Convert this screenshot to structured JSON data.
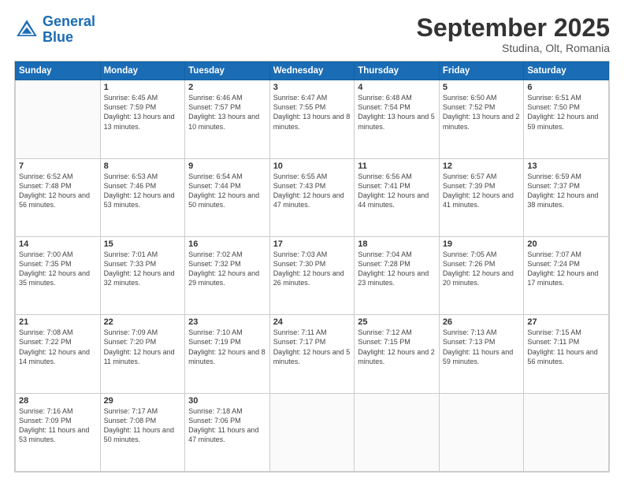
{
  "logo": {
    "line1": "General",
    "line2": "Blue"
  },
  "title": "September 2025",
  "subtitle": "Studina, Olt, Romania",
  "days_header": [
    "Sunday",
    "Monday",
    "Tuesday",
    "Wednesday",
    "Thursday",
    "Friday",
    "Saturday"
  ],
  "weeks": [
    [
      {
        "day": "",
        "sunrise": "",
        "sunset": "",
        "daylight": ""
      },
      {
        "day": "1",
        "sunrise": "Sunrise: 6:45 AM",
        "sunset": "Sunset: 7:59 PM",
        "daylight": "Daylight: 13 hours and 13 minutes."
      },
      {
        "day": "2",
        "sunrise": "Sunrise: 6:46 AM",
        "sunset": "Sunset: 7:57 PM",
        "daylight": "Daylight: 13 hours and 10 minutes."
      },
      {
        "day": "3",
        "sunrise": "Sunrise: 6:47 AM",
        "sunset": "Sunset: 7:55 PM",
        "daylight": "Daylight: 13 hours and 8 minutes."
      },
      {
        "day": "4",
        "sunrise": "Sunrise: 6:48 AM",
        "sunset": "Sunset: 7:54 PM",
        "daylight": "Daylight: 13 hours and 5 minutes."
      },
      {
        "day": "5",
        "sunrise": "Sunrise: 6:50 AM",
        "sunset": "Sunset: 7:52 PM",
        "daylight": "Daylight: 13 hours and 2 minutes."
      },
      {
        "day": "6",
        "sunrise": "Sunrise: 6:51 AM",
        "sunset": "Sunset: 7:50 PM",
        "daylight": "Daylight: 12 hours and 59 minutes."
      }
    ],
    [
      {
        "day": "7",
        "sunrise": "Sunrise: 6:52 AM",
        "sunset": "Sunset: 7:48 PM",
        "daylight": "Daylight: 12 hours and 56 minutes."
      },
      {
        "day": "8",
        "sunrise": "Sunrise: 6:53 AM",
        "sunset": "Sunset: 7:46 PM",
        "daylight": "Daylight: 12 hours and 53 minutes."
      },
      {
        "day": "9",
        "sunrise": "Sunrise: 6:54 AM",
        "sunset": "Sunset: 7:44 PM",
        "daylight": "Daylight: 12 hours and 50 minutes."
      },
      {
        "day": "10",
        "sunrise": "Sunrise: 6:55 AM",
        "sunset": "Sunset: 7:43 PM",
        "daylight": "Daylight: 12 hours and 47 minutes."
      },
      {
        "day": "11",
        "sunrise": "Sunrise: 6:56 AM",
        "sunset": "Sunset: 7:41 PM",
        "daylight": "Daylight: 12 hours and 44 minutes."
      },
      {
        "day": "12",
        "sunrise": "Sunrise: 6:57 AM",
        "sunset": "Sunset: 7:39 PM",
        "daylight": "Daylight: 12 hours and 41 minutes."
      },
      {
        "day": "13",
        "sunrise": "Sunrise: 6:59 AM",
        "sunset": "Sunset: 7:37 PM",
        "daylight": "Daylight: 12 hours and 38 minutes."
      }
    ],
    [
      {
        "day": "14",
        "sunrise": "Sunrise: 7:00 AM",
        "sunset": "Sunset: 7:35 PM",
        "daylight": "Daylight: 12 hours and 35 minutes."
      },
      {
        "day": "15",
        "sunrise": "Sunrise: 7:01 AM",
        "sunset": "Sunset: 7:33 PM",
        "daylight": "Daylight: 12 hours and 32 minutes."
      },
      {
        "day": "16",
        "sunrise": "Sunrise: 7:02 AM",
        "sunset": "Sunset: 7:32 PM",
        "daylight": "Daylight: 12 hours and 29 minutes."
      },
      {
        "day": "17",
        "sunrise": "Sunrise: 7:03 AM",
        "sunset": "Sunset: 7:30 PM",
        "daylight": "Daylight: 12 hours and 26 minutes."
      },
      {
        "day": "18",
        "sunrise": "Sunrise: 7:04 AM",
        "sunset": "Sunset: 7:28 PM",
        "daylight": "Daylight: 12 hours and 23 minutes."
      },
      {
        "day": "19",
        "sunrise": "Sunrise: 7:05 AM",
        "sunset": "Sunset: 7:26 PM",
        "daylight": "Daylight: 12 hours and 20 minutes."
      },
      {
        "day": "20",
        "sunrise": "Sunrise: 7:07 AM",
        "sunset": "Sunset: 7:24 PM",
        "daylight": "Daylight: 12 hours and 17 minutes."
      }
    ],
    [
      {
        "day": "21",
        "sunrise": "Sunrise: 7:08 AM",
        "sunset": "Sunset: 7:22 PM",
        "daylight": "Daylight: 12 hours and 14 minutes."
      },
      {
        "day": "22",
        "sunrise": "Sunrise: 7:09 AM",
        "sunset": "Sunset: 7:20 PM",
        "daylight": "Daylight: 12 hours and 11 minutes."
      },
      {
        "day": "23",
        "sunrise": "Sunrise: 7:10 AM",
        "sunset": "Sunset: 7:19 PM",
        "daylight": "Daylight: 12 hours and 8 minutes."
      },
      {
        "day": "24",
        "sunrise": "Sunrise: 7:11 AM",
        "sunset": "Sunset: 7:17 PM",
        "daylight": "Daylight: 12 hours and 5 minutes."
      },
      {
        "day": "25",
        "sunrise": "Sunrise: 7:12 AM",
        "sunset": "Sunset: 7:15 PM",
        "daylight": "Daylight: 12 hours and 2 minutes."
      },
      {
        "day": "26",
        "sunrise": "Sunrise: 7:13 AM",
        "sunset": "Sunset: 7:13 PM",
        "daylight": "Daylight: 11 hours and 59 minutes."
      },
      {
        "day": "27",
        "sunrise": "Sunrise: 7:15 AM",
        "sunset": "Sunset: 7:11 PM",
        "daylight": "Daylight: 11 hours and 56 minutes."
      }
    ],
    [
      {
        "day": "28",
        "sunrise": "Sunrise: 7:16 AM",
        "sunset": "Sunset: 7:09 PM",
        "daylight": "Daylight: 11 hours and 53 minutes."
      },
      {
        "day": "29",
        "sunrise": "Sunrise: 7:17 AM",
        "sunset": "Sunset: 7:08 PM",
        "daylight": "Daylight: 11 hours and 50 minutes."
      },
      {
        "day": "30",
        "sunrise": "Sunrise: 7:18 AM",
        "sunset": "Sunset: 7:06 PM",
        "daylight": "Daylight: 11 hours and 47 minutes."
      },
      {
        "day": "",
        "sunrise": "",
        "sunset": "",
        "daylight": ""
      },
      {
        "day": "",
        "sunrise": "",
        "sunset": "",
        "daylight": ""
      },
      {
        "day": "",
        "sunrise": "",
        "sunset": "",
        "daylight": ""
      },
      {
        "day": "",
        "sunrise": "",
        "sunset": "",
        "daylight": ""
      }
    ]
  ]
}
